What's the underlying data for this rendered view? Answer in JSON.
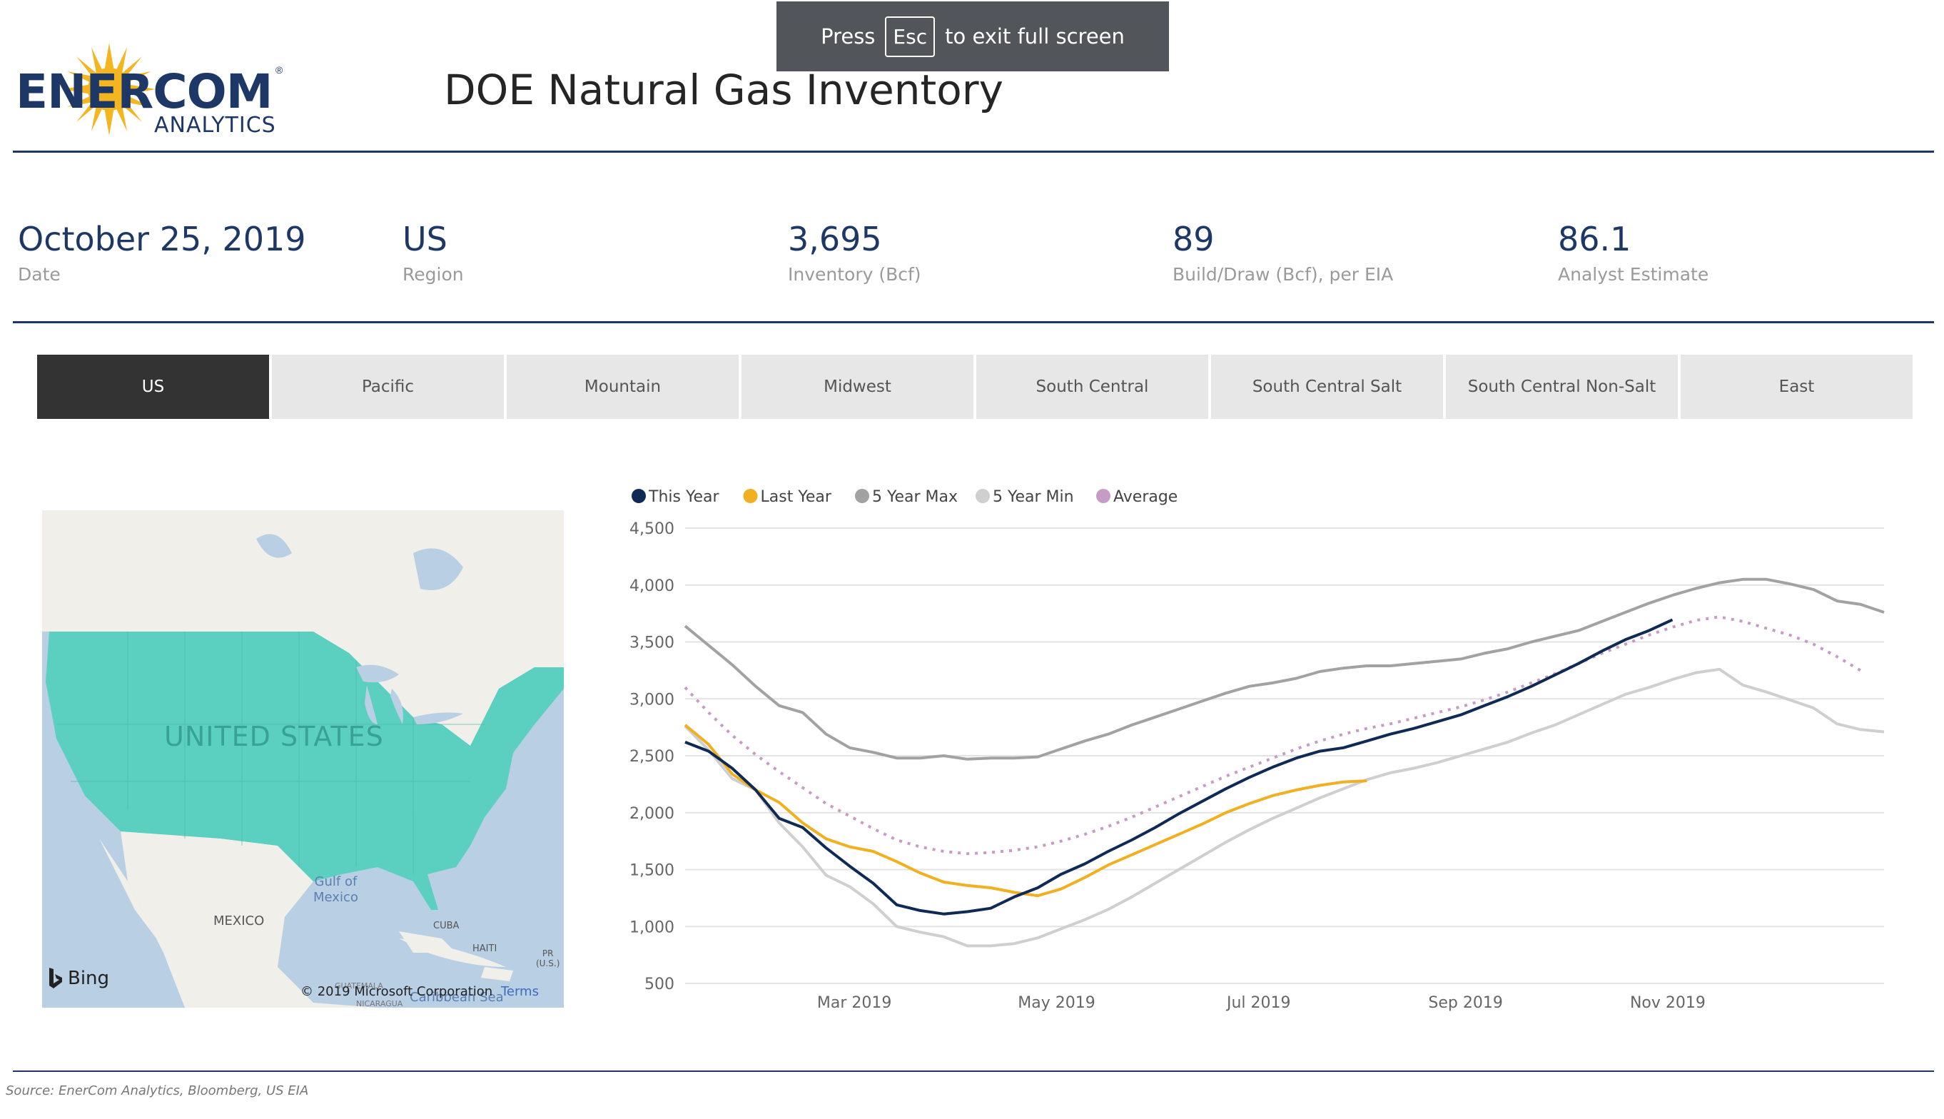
{
  "toast": {
    "prefix": "Press",
    "key": "Esc",
    "suffix": "to exit full screen"
  },
  "logo": {
    "brand": "ENERCOM",
    "sub": "ANALYTICS",
    "reg": "®"
  },
  "header": {
    "title": "DOE Natural Gas Inventory"
  },
  "kpis": [
    {
      "value": "October 25, 2019",
      "label": "Date"
    },
    {
      "value": "US",
      "label": "Region"
    },
    {
      "value": "3,695",
      "label": "Inventory (Bcf)"
    },
    {
      "value": "89",
      "label": "Build/Draw (Bcf), per EIA"
    },
    {
      "value": "86.1",
      "label": "Analyst Estimate"
    }
  ],
  "tabs": [
    "US",
    "Pacific",
    "Mountain",
    "Midwest",
    "South Central",
    "South Central Salt",
    "South Central Non-Salt",
    "East"
  ],
  "active_tab": "US",
  "map": {
    "country_label": "UNITED STATES",
    "labels": {
      "gulf_line1": "Gulf of",
      "gulf_line2": "Mexico",
      "mexico": "MEXICO",
      "cuba": "CUBA",
      "haiti": "HAITI",
      "pr": "PR",
      "pr2": "(U.S.)",
      "caribbean": "Caribbean Sea",
      "guatemala": "GUATEMALA",
      "nicaragua": "NICARAGUA"
    },
    "attribution": "© 2019 Microsoft Corporation",
    "terms": "Terms",
    "bing": "Bing",
    "colors": {
      "water": "#b9cfe4",
      "land": "#f1efe9",
      "highlight": "#5bcfc0"
    }
  },
  "source": {
    "prefix": "Source:",
    "text": "EnerCom Analytics, Bloomberg, US EIA"
  },
  "chart_data": {
    "type": "line",
    "y_ticks": [
      "4,500",
      "4,000",
      "3,500",
      "3,000",
      "2,500",
      "2,000",
      "1,500",
      "1,000",
      "500"
    ],
    "ylim": [
      500,
      4500
    ],
    "x_tick_labels": [
      "Mar 2019",
      "May 2019",
      "Jul 2019",
      "Sep 2019",
      "Nov 2019"
    ],
    "x_tick_weeks": [
      7.2,
      15.8,
      24.4,
      33.2,
      41.8
    ],
    "grid": true,
    "legend_position": "top-left",
    "series": [
      {
        "name": "This Year",
        "color": "#0f2a55",
        "dash": false,
        "values": [
          2620,
          2540,
          2390,
          2200,
          1950,
          1870,
          1690,
          1530,
          1380,
          1190,
          1140,
          1110,
          1130,
          1160,
          1260,
          1340,
          1460,
          1550,
          1660,
          1760,
          1870,
          1990,
          2100,
          2210,
          2310,
          2400,
          2480,
          2540,
          2570,
          2630,
          2690,
          2740,
          2800,
          2860,
          2940,
          3020,
          3110,
          3210,
          3310,
          3420,
          3520,
          3600,
          3695
        ]
      },
      {
        "name": "Last Year",
        "color": "#f0b021",
        "dash": false,
        "values": [
          2770,
          2600,
          2340,
          2200,
          2090,
          1910,
          1770,
          1700,
          1660,
          1570,
          1470,
          1390,
          1360,
          1340,
          1300,
          1270,
          1330,
          1430,
          1540,
          1630,
          1720,
          1810,
          1900,
          2000,
          2080,
          2150,
          2200,
          2240,
          2270,
          2280
        ]
      },
      {
        "name": "5 Year Max",
        "color": "#a2a2a2",
        "dash": false,
        "values": [
          3640,
          3470,
          3300,
          3110,
          2940,
          2880,
          2690,
          2570,
          2530,
          2480,
          2480,
          2500,
          2470,
          2480,
          2480,
          2490,
          2560,
          2630,
          2690,
          2770,
          2840,
          2910,
          2980,
          3050,
          3110,
          3140,
          3180,
          3240,
          3270,
          3290,
          3290,
          3310,
          3330,
          3350,
          3400,
          3440,
          3500,
          3550,
          3600,
          3680,
          3760,
          3840,
          3910,
          3970,
          4020,
          4050,
          4050,
          4010,
          3960,
          3860,
          3830,
          3760
        ]
      },
      {
        "name": "5 Year Min",
        "color": "#cfcfcf",
        "dash": false,
        "values": [
          2760,
          2550,
          2300,
          2200,
          1910,
          1700,
          1450,
          1350,
          1200,
          1000,
          950,
          910,
          830,
          830,
          850,
          900,
          980,
          1060,
          1150,
          1260,
          1380,
          1500,
          1620,
          1740,
          1850,
          1950,
          2040,
          2130,
          2210,
          2290,
          2350,
          2390,
          2440,
          2500,
          2560,
          2620,
          2700,
          2770,
          2860,
          2950,
          3040,
          3100,
          3170,
          3230,
          3260,
          3120,
          3060,
          2990,
          2920,
          2780,
          2730,
          2710
        ]
      },
      {
        "name": "Average",
        "color": "#c69cc4",
        "dash": true,
        "values": [
          3100,
          2880,
          2680,
          2510,
          2360,
          2220,
          2080,
          1970,
          1860,
          1760,
          1700,
          1660,
          1640,
          1650,
          1670,
          1700,
          1750,
          1810,
          1880,
          1960,
          2050,
          2140,
          2230,
          2320,
          2400,
          2480,
          2560,
          2630,
          2690,
          2740,
          2780,
          2830,
          2880,
          2930,
          2990,
          3060,
          3140,
          3220,
          3310,
          3400,
          3480,
          3560,
          3630,
          3690,
          3720,
          3680,
          3620,
          3560,
          3480,
          3370,
          3250
        ]
      }
    ]
  }
}
